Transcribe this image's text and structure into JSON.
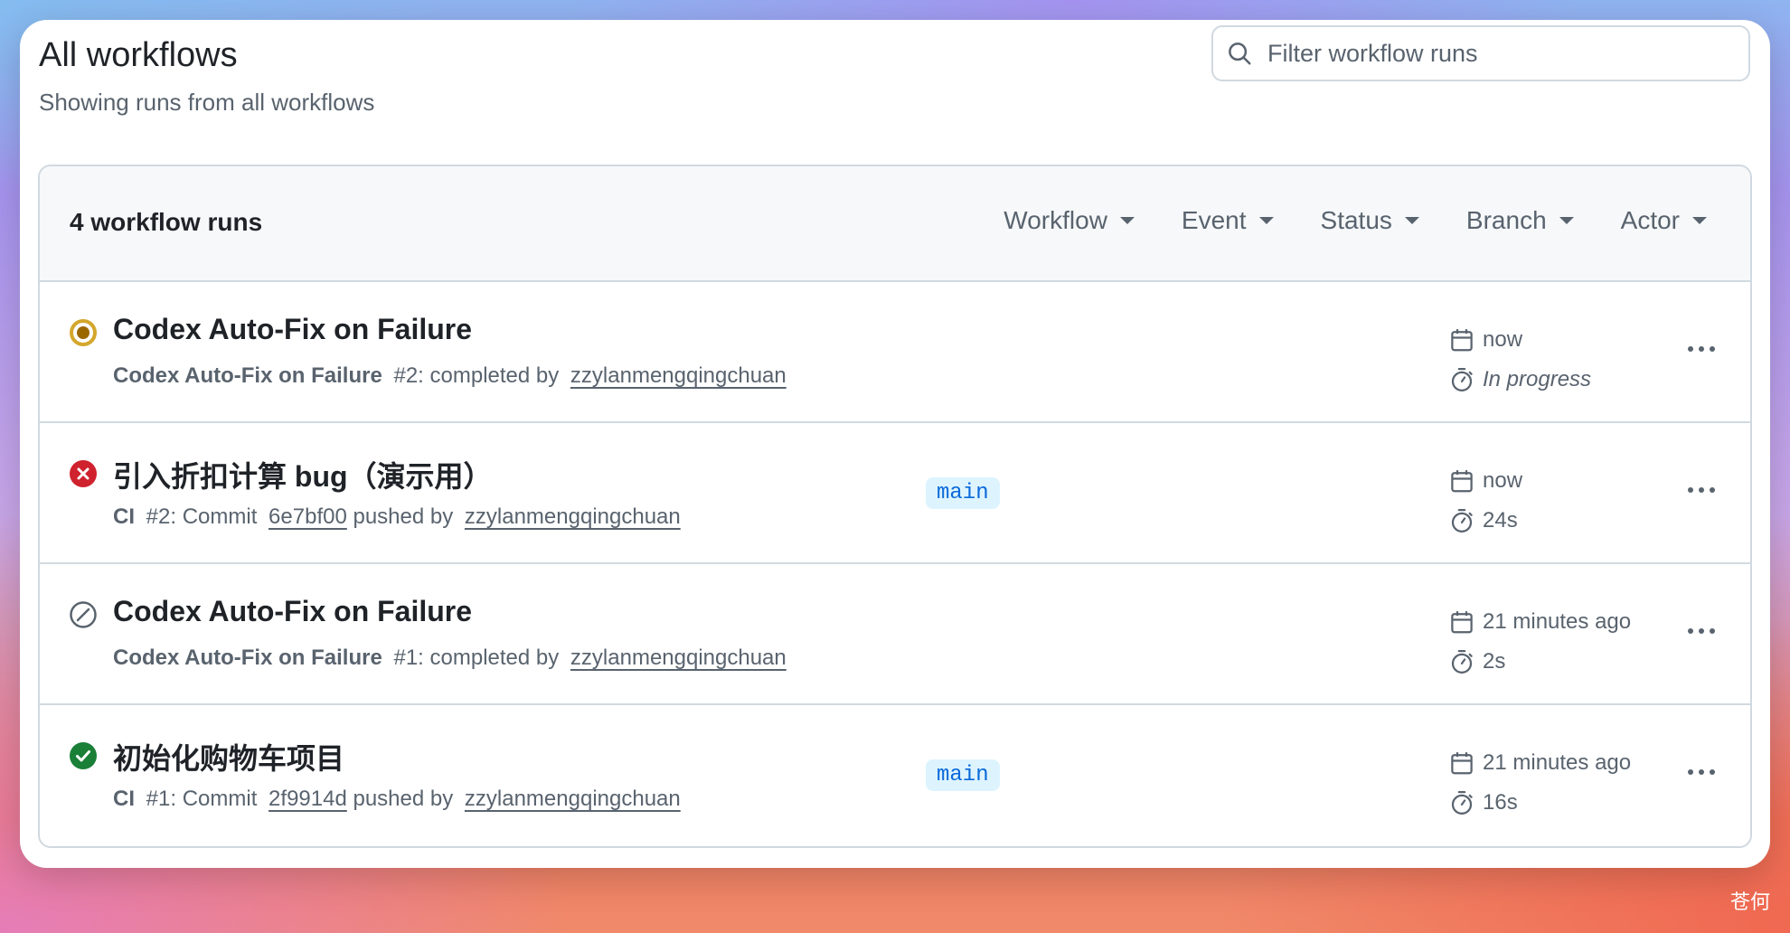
{
  "page": {
    "title": "All workflows",
    "subtitle": "Showing runs from all workflows"
  },
  "search": {
    "placeholder": "Filter workflow runs",
    "icon": "search-icon"
  },
  "list": {
    "count_label": "4 workflow runs",
    "filters": [
      "Workflow",
      "Event",
      "Status",
      "Branch",
      "Actor"
    ]
  },
  "runs": [
    {
      "status": "in-progress",
      "status_color": "#9a6700",
      "title": "Codex Auto-Fix on Failure",
      "workflow": "Codex Auto-Fix on Failure",
      "run_number": "#2",
      "action_prefix": ": completed by ",
      "commit": "",
      "actor": "zzylanmengqingchuan",
      "branch": "",
      "time": "now",
      "duration": "In progress"
    },
    {
      "status": "failure",
      "status_color": "#cf222e",
      "title": "引入折扣计算 bug（演示用）",
      "workflow": "CI",
      "run_number": "#2",
      "action_prefix": ": Commit ",
      "commit": "6e7bf00",
      "pushed_label": " pushed by ",
      "actor": "zzylanmengqingchuan",
      "branch": "main",
      "time": "now",
      "duration": "24s"
    },
    {
      "status": "cancelled",
      "status_color": "#59636e",
      "title": "Codex Auto-Fix on Failure",
      "workflow": "Codex Auto-Fix on Failure",
      "run_number": "#1",
      "action_prefix": ": completed by ",
      "commit": "",
      "actor": "zzylanmengqingchuan",
      "branch": "",
      "time": "21 minutes ago",
      "duration": "2s"
    },
    {
      "status": "success",
      "status_color": "#1a7f37",
      "title": "初始化购物车项目",
      "workflow": "CI",
      "run_number": "#1",
      "action_prefix": ": Commit ",
      "commit": "2f9914d",
      "pushed_label": " pushed by ",
      "actor": "zzylanmengqingchuan",
      "branch": "main",
      "time": "21 minutes ago",
      "duration": "16s"
    }
  ],
  "watermark": "苍何"
}
